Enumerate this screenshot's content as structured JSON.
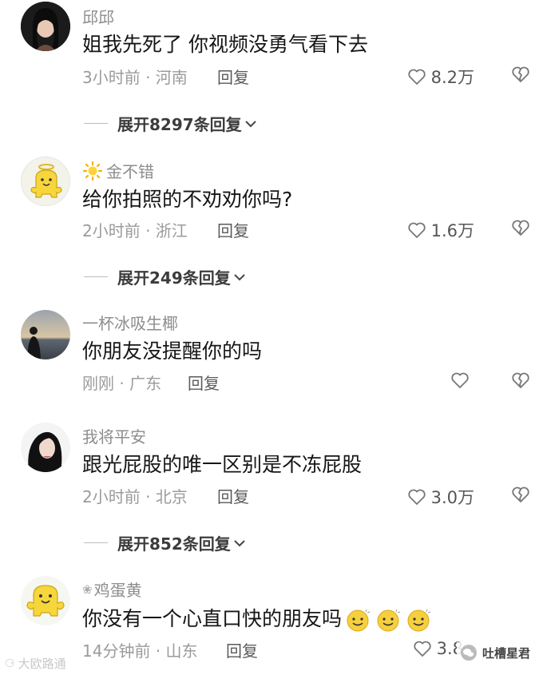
{
  "comments": [
    {
      "username": "邱邱",
      "text": "姐我先死了 你视频没勇气看下去",
      "meta": "3小时前 · 河南",
      "reply": "回复",
      "likes": "8.2万",
      "expand": "展开8297条回复"
    },
    {
      "username": "金不错",
      "text": "给你拍照的不劝劝你吗?",
      "meta": "2小时前 · 浙江",
      "reply": "回复",
      "likes": "1.6万",
      "expand": "展开249条回复"
    },
    {
      "username": "一杯冰吸生椰",
      "text": "你朋友没提醒你的吗",
      "meta": "刚刚 · 广东",
      "reply": "回复",
      "likes": ""
    },
    {
      "username": "我将平安",
      "text": "跟光屁股的唯一区别是不冻屁股",
      "meta": "2小时前 · 北京",
      "reply": "回复",
      "likes": "3.0万",
      "expand": "展开852条回复"
    },
    {
      "username": "鸡蛋黄",
      "text": "你没有一个心直口快的朋友吗",
      "meta": "14分钟前 · 山东",
      "reply": "回复",
      "likes": "3.8"
    }
  ],
  "watermarks": {
    "left": "大欧路通",
    "right": "吐槽星君"
  },
  "icons": {
    "like": "heart-outline-icon",
    "dislike": "broken-heart-icon",
    "expand": "chevron-down-icon",
    "sun": "sun-icon"
  },
  "colors": {
    "text": "#161616",
    "muted": "#9b9b9b",
    "username": "#8d8d8d"
  }
}
